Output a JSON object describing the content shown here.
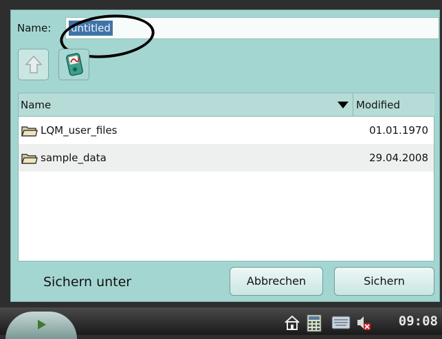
{
  "dialog": {
    "name_label": "Name:",
    "name_value": "untitled",
    "columns": {
      "name": "Name",
      "modified": "Modified"
    },
    "files": [
      {
        "name": "LQM_user_files",
        "modified": "01.01.1970"
      },
      {
        "name": "sample_data",
        "modified": "29.04.2008"
      }
    ],
    "status_title": "Sichern unter",
    "buttons": {
      "cancel": "Abbrechen",
      "save": "Sichern"
    }
  },
  "taskbar": {
    "clock": "09:08"
  },
  "icons": {
    "up": "arrow-up-icon",
    "device": "device-icon",
    "folder": "folder-icon",
    "sort": "sort-down-icon",
    "start": "play-icon",
    "home": "home-icon",
    "calc": "calculator-icon",
    "keyboard": "keyboard-icon",
    "volume": "volume-muted-icon"
  },
  "colors": {
    "dialog_bg": "#a4d6d1",
    "selection": "#3f74a8",
    "taskbar": "#2a2a2a"
  }
}
